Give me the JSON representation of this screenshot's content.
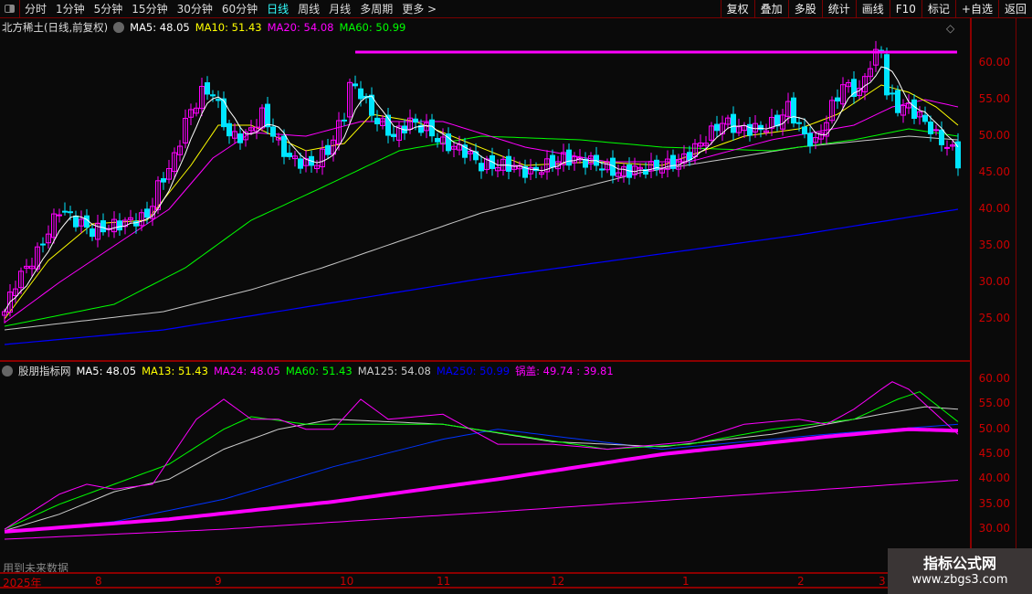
{
  "toolbar": {
    "periods": [
      "分时",
      "1分钟",
      "5分钟",
      "15分钟",
      "30分钟",
      "60分钟",
      "日线",
      "周线",
      "月线",
      "多周期",
      "更多 >"
    ],
    "active": "日线",
    "right_buttons": [
      "复权",
      "叠加",
      "多股",
      "统计",
      "画线",
      "F10",
      "标记",
      "+自选",
      "返回"
    ]
  },
  "main_legend": {
    "title": "北方稀土(日线,前复权)",
    "ma5": "MA5: 48.05",
    "ma10": "MA10: 51.43",
    "ma20": "MA20: 54.08",
    "ma60": "MA60: 50.99"
  },
  "sub_legend": {
    "title": "股朋指标网",
    "ma5": "MA5: 48.05",
    "ma13": "MA13: 51.43",
    "ma24": "MA24: 48.05",
    "ma60": "MA60: 51.43",
    "ma125": "MA125: 54.08",
    "ma250": "MA250: 50.99",
    "guogai": "锅盖: 49.74 : 39.81"
  },
  "main_axis": [
    "60.00",
    "55.00",
    "50.00",
    "45.00",
    "40.00",
    "35.00",
    "30.00",
    "25.00"
  ],
  "sub_axis": [
    "60.00",
    "55.00",
    "50.00",
    "45.00",
    "40.00",
    "35.00",
    "30.00"
  ],
  "time_axis": [
    "2025年",
    "8",
    "9",
    "10",
    "11",
    "12",
    "1",
    "2",
    "3"
  ],
  "no_future": "用到未来数据",
  "watermark": {
    "name": "指标公式网",
    "url": "www.zbgs3.com"
  },
  "colors": {
    "up": "#ff00ff",
    "down": "#00e5ff",
    "ma5": "#ffffff",
    "ma10": "#ffff00",
    "ma20": "#ff00ff",
    "ma60": "#00ff00",
    "ma120": "#c8c8c8",
    "ma250": "#0000ff"
  },
  "chart_data": {
    "type": "candlestick",
    "bars": 175,
    "close_keypoints": [
      [
        0,
        26
      ],
      [
        2,
        30
      ],
      [
        6,
        34
      ],
      [
        8,
        37
      ],
      [
        10,
        40
      ],
      [
        12,
        39
      ],
      [
        16,
        37
      ],
      [
        21,
        38
      ],
      [
        26,
        39
      ],
      [
        28,
        43
      ],
      [
        31,
        47
      ],
      [
        33,
        52
      ],
      [
        36,
        56
      ],
      [
        38,
        56
      ],
      [
        41,
        50
      ],
      [
        44,
        50
      ],
      [
        47,
        53
      ],
      [
        50,
        49
      ],
      [
        52,
        47
      ],
      [
        56,
        46
      ],
      [
        59,
        48
      ],
      [
        62,
        53
      ],
      [
        63,
        57
      ],
      [
        65,
        56
      ],
      [
        67,
        53
      ],
      [
        71,
        50
      ],
      [
        74,
        52
      ],
      [
        77,
        51
      ],
      [
        80,
        49
      ],
      [
        84,
        48
      ],
      [
        87,
        46
      ],
      [
        92,
        46
      ],
      [
        96,
        45
      ],
      [
        99,
        46
      ],
      [
        102,
        47
      ],
      [
        107,
        46.5
      ],
      [
        112,
        45
      ],
      [
        116,
        45.5
      ],
      [
        121,
        46
      ],
      [
        124,
        47
      ],
      [
        127,
        49
      ],
      [
        131,
        52
      ],
      [
        134,
        51
      ],
      [
        138,
        51
      ],
      [
        141,
        52
      ],
      [
        143,
        54
      ],
      [
        146,
        50
      ],
      [
        148,
        49
      ],
      [
        151,
        54
      ],
      [
        153,
        57
      ],
      [
        156,
        56
      ],
      [
        158,
        60
      ],
      [
        160,
        62
      ],
      [
        161,
        56
      ],
      [
        163,
        54
      ],
      [
        165,
        54
      ],
      [
        168,
        52
      ],
      [
        170,
        50
      ],
      [
        173,
        48
      ],
      [
        174,
        46.5
      ]
    ],
    "resistance_line": {
      "value": 61.5,
      "from_bar": 64
    },
    "main_lines": {
      "ma10": [
        [
          0,
          25
        ],
        [
          8,
          33
        ],
        [
          16,
          38
        ],
        [
          26,
          38.5
        ],
        [
          34,
          46
        ],
        [
          39,
          51.5
        ],
        [
          45,
          51.5
        ],
        [
          55,
          48
        ],
        [
          62,
          49
        ],
        [
          67,
          53
        ],
        [
          75,
          52
        ],
        [
          85,
          49
        ],
        [
          95,
          46
        ],
        [
          108,
          46.5
        ],
        [
          120,
          46
        ],
        [
          135,
          50
        ],
        [
          145,
          51
        ],
        [
          152,
          53
        ],
        [
          160,
          57
        ],
        [
          165,
          56
        ],
        [
          170,
          54
        ],
        [
          174,
          51.5
        ]
      ],
      "ma20": [
        [
          0,
          24.5
        ],
        [
          10,
          30
        ],
        [
          20,
          35
        ],
        [
          30,
          40
        ],
        [
          38,
          47
        ],
        [
          45,
          50.5
        ],
        [
          55,
          50
        ],
        [
          65,
          52
        ],
        [
          80,
          52
        ],
        [
          95,
          48.5
        ],
        [
          110,
          46.5
        ],
        [
          125,
          46.5
        ],
        [
          140,
          49.5
        ],
        [
          155,
          51.5
        ],
        [
          162,
          54
        ],
        [
          168,
          55
        ],
        [
          174,
          54
        ]
      ],
      "ma60": [
        [
          0,
          24
        ],
        [
          20,
          27
        ],
        [
          33,
          32
        ],
        [
          45,
          38.5
        ],
        [
          58,
          43
        ],
        [
          72,
          48
        ],
        [
          87,
          50
        ],
        [
          105,
          49.5
        ],
        [
          120,
          48.5
        ],
        [
          140,
          48
        ],
        [
          155,
          49.5
        ],
        [
          165,
          51
        ],
        [
          174,
          50
        ]
      ],
      "ma120": [
        [
          0,
          23.5
        ],
        [
          29,
          26
        ],
        [
          45,
          29
        ],
        [
          58,
          32
        ],
        [
          87,
          39.5
        ],
        [
          116,
          45
        ],
        [
          145,
          48.5
        ],
        [
          165,
          50
        ],
        [
          174,
          49.5
        ]
      ],
      "ma250": [
        [
          0,
          21.5
        ],
        [
          29,
          23.5
        ],
        [
          58,
          27
        ],
        [
          87,
          30.5
        ],
        [
          116,
          33.5
        ],
        [
          145,
          36.5
        ],
        [
          174,
          40
        ]
      ]
    },
    "sub_lines": {
      "guogai": [
        [
          0,
          29.5
        ],
        [
          30,
          32
        ],
        [
          60,
          35.5
        ],
        [
          90,
          40
        ],
        [
          120,
          45
        ],
        [
          150,
          48.5
        ],
        [
          165,
          50
        ],
        [
          174,
          49.7
        ]
      ],
      "guogai_low": [
        [
          0,
          28
        ],
        [
          40,
          30
        ],
        [
          90,
          33.5
        ],
        [
          130,
          36.5
        ],
        [
          174,
          39.8
        ]
      ],
      "ma250": [
        [
          0,
          29.5
        ],
        [
          20,
          31.5
        ],
        [
          40,
          36
        ],
        [
          60,
          42.5
        ],
        [
          80,
          48
        ],
        [
          90,
          50
        ],
        [
          120,
          46
        ],
        [
          150,
          49
        ],
        [
          174,
          51
        ]
      ],
      "ma125": [
        [
          0,
          29.7
        ],
        [
          10,
          33
        ],
        [
          20,
          37.5
        ],
        [
          30,
          40
        ],
        [
          40,
          46
        ],
        [
          50,
          50
        ],
        [
          60,
          52
        ],
        [
          80,
          51
        ],
        [
          100,
          47.5
        ],
        [
          120,
          46.5
        ],
        [
          140,
          49
        ],
        [
          160,
          53
        ],
        [
          168,
          54.5
        ],
        [
          174,
          54
        ]
      ],
      "ma60": [
        [
          0,
          30
        ],
        [
          10,
          35
        ],
        [
          20,
          39
        ],
        [
          30,
          43
        ],
        [
          40,
          50
        ],
        [
          45,
          52.5
        ],
        [
          55,
          51
        ],
        [
          65,
          51
        ],
        [
          80,
          51
        ],
        [
          95,
          48.5
        ],
        [
          110,
          46
        ],
        [
          125,
          47
        ],
        [
          140,
          50
        ],
        [
          155,
          52
        ],
        [
          163,
          56
        ],
        [
          167,
          57.5
        ],
        [
          174,
          51.5
        ]
      ],
      "ma24": [
        [
          0,
          30
        ],
        [
          10,
          37
        ],
        [
          15,
          39
        ],
        [
          20,
          38
        ],
        [
          27,
          39
        ],
        [
          35,
          52
        ],
        [
          40,
          56
        ],
        [
          45,
          52
        ],
        [
          50,
          52
        ],
        [
          55,
          50
        ],
        [
          60,
          50
        ],
        [
          65,
          56
        ],
        [
          70,
          52
        ],
        [
          80,
          53
        ],
        [
          85,
          50
        ],
        [
          90,
          47
        ],
        [
          100,
          47
        ],
        [
          110,
          46
        ],
        [
          125,
          47.5
        ],
        [
          135,
          51
        ],
        [
          145,
          52
        ],
        [
          150,
          51
        ],
        [
          155,
          54
        ],
        [
          160,
          58
        ],
        [
          162,
          59.5
        ],
        [
          165,
          58
        ],
        [
          168,
          55
        ],
        [
          174,
          49
        ]
      ]
    }
  }
}
